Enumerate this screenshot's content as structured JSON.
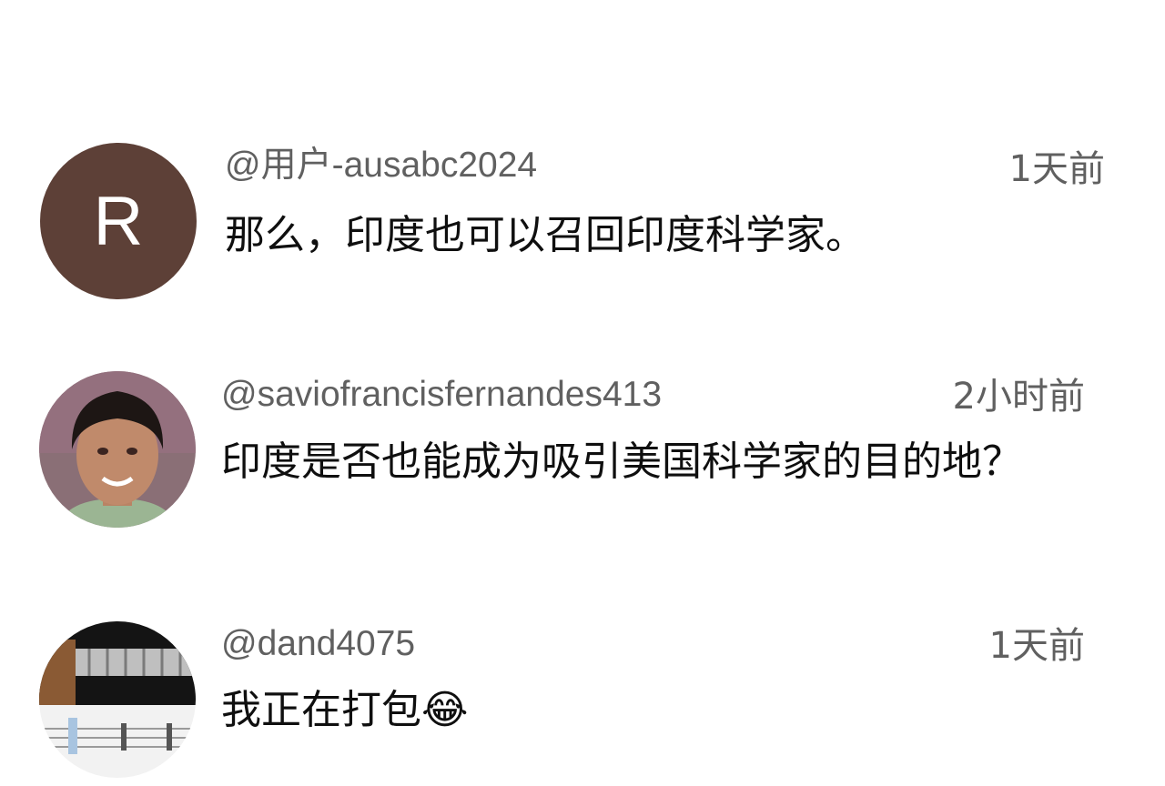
{
  "comments": [
    {
      "handle": "@用户-ausabc2024",
      "time": "1天前",
      "text": "那么，印度也可以召回印度科学家。",
      "avatar_letter": "R",
      "avatar_color": "#5d4037"
    },
    {
      "handle": "@saviofrancisfernandes413",
      "time": "2小时前",
      "text": "印度是否也能成为吸引美国科学家的目的地？",
      "avatar_kind": "photo-portrait"
    },
    {
      "handle": "@dand4075",
      "time": "1天前",
      "text": "我正在打包",
      "emoji": "😂",
      "avatar_kind": "photo-guitar-tab"
    }
  ]
}
